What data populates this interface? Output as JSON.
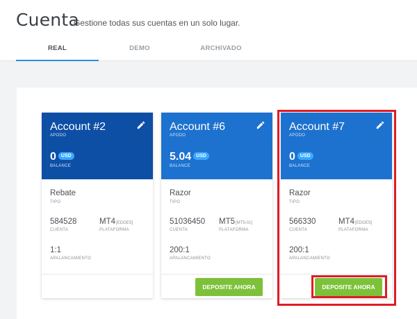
{
  "header": {
    "title": "Cuenta",
    "subtitle": "Gestione todas sus cuentas en un solo lugar.",
    "tabs": [
      {
        "label": "REAL",
        "active": true
      },
      {
        "label": "DEMO",
        "active": false
      },
      {
        "label": "ARCHIVADO",
        "active": false
      }
    ]
  },
  "colors": {
    "accent": "#2a8fd6",
    "card_head_dark": "#0e4fa6",
    "card_head_light": "#1d72cf",
    "button": "#7dc13a",
    "highlight": "#e01b24"
  },
  "labels": {
    "apodo": "APODO",
    "balance": "BALANCE",
    "tipo": "TIPO",
    "cuenta": "CUENTA",
    "plataforma": "PLATAFORMA",
    "apalancamiento": "APALANCAMIENTO",
    "deposit_button": "DEPOSITE AHORA"
  },
  "accounts": [
    {
      "title": "Account #2",
      "balance": "0",
      "currency": "USD",
      "type": "Rebate",
      "number": "584528",
      "platform": "MT4",
      "platform_sub": "[EDGES]",
      "leverage": "1:1",
      "has_deposit": false
    },
    {
      "title": "Account #6",
      "balance": "5.04",
      "currency": "USD",
      "type": "Razor",
      "number": "51036450",
      "platform": "MT5",
      "platform_sub": "[MT5-01]",
      "leverage": "200:1",
      "has_deposit": true
    },
    {
      "title": "Account #7",
      "balance": "0",
      "currency": "USD",
      "type": "Razor",
      "number": "566330",
      "platform": "MT4",
      "platform_sub": "[EDGES]",
      "leverage": "200:1",
      "has_deposit": true
    }
  ]
}
